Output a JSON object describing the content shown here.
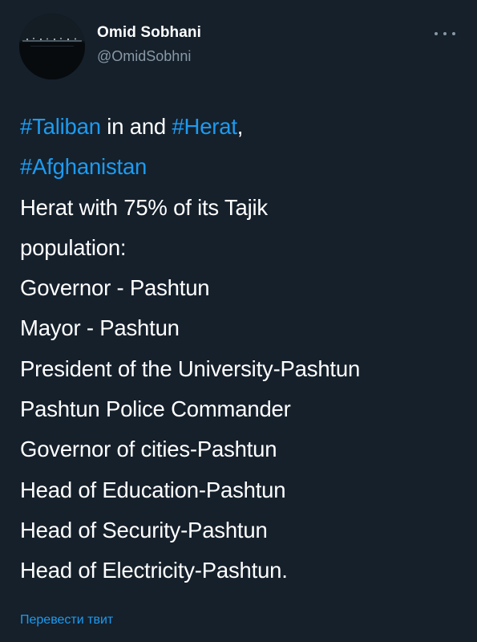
{
  "author": {
    "name": "Omid Sobhani",
    "handle": "@OmidSobhni",
    "avatar_icon": "avatar-night-cityscape"
  },
  "more_icon": "more-horizontal-icon",
  "colors": {
    "background": "#15202b",
    "text": "#ffffff",
    "secondary_text": "#8899a6",
    "link": "#1d9bf0"
  },
  "tweet": {
    "line1": {
      "tag1": "#Taliban",
      "mid": " in and ",
      "tag2": "#Herat",
      "tail": ","
    },
    "line2": {
      "tag": "#Afghanistan"
    },
    "body_lines": [
      "Herat with 75% of its Tajik",
      "population:",
      "Governor - Pashtun",
      "Mayor - Pashtun",
      "President of the University-Pashtun",
      "Pashtun Police Commander",
      "Governor of cities-Pashtun",
      "Head of Education-Pashtun",
      "Head of Security-Pashtun",
      "Head of Electricity-Pashtun."
    ]
  },
  "translate_label": "Перевести твит"
}
